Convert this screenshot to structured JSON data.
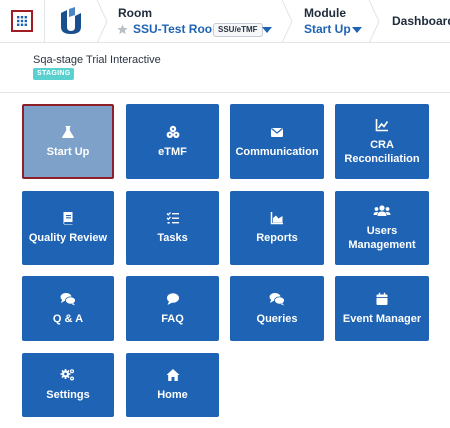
{
  "topbar": {
    "room_label": "Room",
    "room_name": "SSU-Test Room",
    "room_tag": "SSU/eTMF",
    "module_label": "Module",
    "module_name": "Start Up",
    "dashboard": "Dashboard"
  },
  "study": {
    "name": "Sqa-stage Trial Interactive",
    "environment": "STAGING"
  },
  "colors": {
    "tile": "#1f63b4",
    "tile_active": "#7da1c8",
    "active_border": "#8c1f2a",
    "badge": "#5ad1cf",
    "link": "#1f63b4"
  },
  "modules": [
    {
      "label": "Start Up",
      "icon": "flask-icon",
      "selected": true
    },
    {
      "label": "eTMF",
      "icon": "cubes-icon",
      "selected": false
    },
    {
      "label": "Communication",
      "icon": "envelope-icon",
      "selected": false
    },
    {
      "label": "CRA Reconciliation",
      "icon": "line-chart-icon",
      "selected": false
    },
    {
      "label": "Quality Review",
      "icon": "book-icon",
      "selected": false
    },
    {
      "label": "Tasks",
      "icon": "task-list-icon",
      "selected": false
    },
    {
      "label": "Reports",
      "icon": "area-chart-icon",
      "selected": false
    },
    {
      "label": "Users Management",
      "icon": "users-icon",
      "selected": false
    },
    {
      "label": "Q & A",
      "icon": "comments-icon",
      "selected": false
    },
    {
      "label": "FAQ",
      "icon": "comment-icon",
      "selected": false
    },
    {
      "label": "Queries",
      "icon": "comments-icon",
      "selected": false
    },
    {
      "label": "Event Manager",
      "icon": "calendar-icon",
      "selected": false
    },
    {
      "label": "Settings",
      "icon": "gears-icon",
      "selected": false
    },
    {
      "label": "Home",
      "icon": "home-icon",
      "selected": false
    }
  ]
}
